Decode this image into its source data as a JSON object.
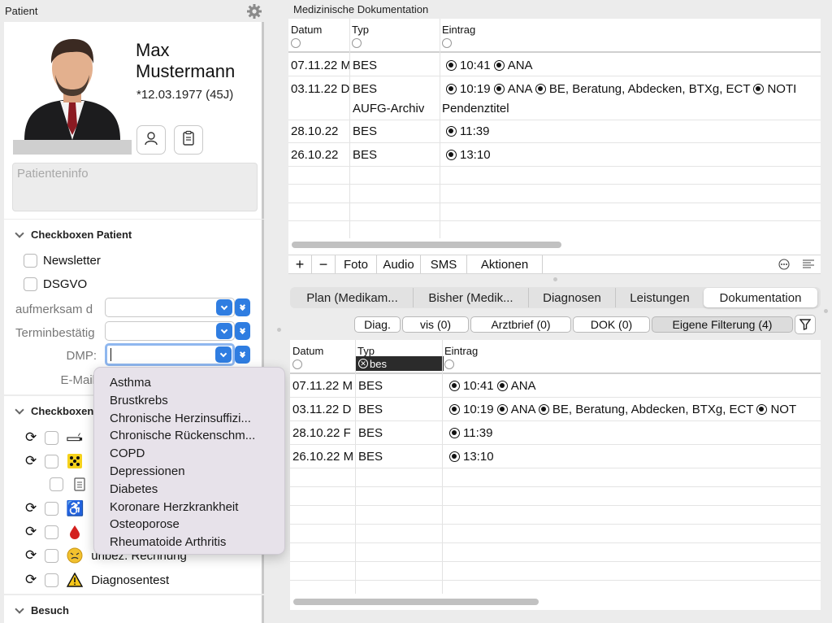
{
  "left": {
    "title": "Patient",
    "patient": {
      "first_name": "Max",
      "last_name": "Mustermann",
      "dob": "*12.03.1977 (45J)",
      "info_placeholder": "Patienteninfo"
    },
    "checkboxes_section": {
      "title": "Checkboxen Patient",
      "items": [
        {
          "label": "Newsletter",
          "checked": false
        },
        {
          "label": "DSGVO",
          "checked": false
        }
      ],
      "fields": [
        {
          "label": "aufmerksam d",
          "value": ""
        },
        {
          "label": "Terminbestätig",
          "value": ""
        },
        {
          "label": "DMP:",
          "value": ""
        },
        {
          "label": "E-Mail",
          "value": ""
        }
      ]
    },
    "checkboxes2_section": {
      "title": "Checkboxen",
      "rows": [
        {
          "icon": "cigarette-icon",
          "label": ""
        },
        {
          "icon": "yellow-dots-icon",
          "label": ""
        },
        {
          "icon": "clipboard-icon",
          "label": ""
        },
        {
          "icon": "wheelchair-icon",
          "label": ""
        },
        {
          "icon": "blood-drop-icon",
          "label": ""
        },
        {
          "icon": "dizzy-face-icon",
          "label": "unbez. Rechnung"
        },
        {
          "icon": "warning-icon",
          "label": "Diagnosentest"
        }
      ]
    },
    "besuch_section": {
      "title": "Besuch"
    },
    "dmp_dropdown": {
      "options": [
        "Asthma",
        "Brustkrebs",
        "Chronische Herzinsuffizi...",
        "Chronische Rückenschm...",
        "COPD",
        "Depressionen",
        "Diabetes",
        "Koronare Herzkrankheit",
        "Osteoporose",
        "Rheumatoide Arthritis"
      ]
    }
  },
  "right": {
    "title": "Medizinische Dokumentation",
    "top_table": {
      "columns": [
        "Datum",
        "Typ",
        "Eintrag"
      ],
      "rows": [
        {
          "datum": "07.11.22",
          "suffix": "M",
          "typ": "BES",
          "entry": [
            {
              "dot": true,
              "text": "10:41"
            },
            {
              "dot": true,
              "text": "ANA"
            }
          ]
        },
        {
          "datum": "03.11.22",
          "suffix": "D",
          "typ": "BES",
          "entry": [
            {
              "dot": true,
              "text": "10:19"
            },
            {
              "dot": true,
              "text": "ANA"
            },
            {
              "dot": true,
              "text": "BE, Beratung, Abdecken, BTXg, ECT"
            },
            {
              "dot": true,
              "text": "NOTI"
            }
          ]
        },
        {
          "datum": "",
          "suffix": "",
          "typ": "AUFG-Archiv",
          "entry": [
            {
              "dot": false,
              "text": "Pendenztitel"
            }
          ]
        },
        {
          "datum": "28.10.22",
          "suffix": "",
          "typ": "BES",
          "entry": [
            {
              "dot": true,
              "text": "11:39"
            }
          ]
        },
        {
          "datum": "26.10.22",
          "suffix": "",
          "typ": "BES",
          "entry": [
            {
              "dot": true,
              "text": "13:10"
            }
          ]
        }
      ]
    },
    "toolbar": {
      "add": "+",
      "remove": "−",
      "buttons": [
        "Foto",
        "Audio",
        "SMS",
        "Aktionen"
      ]
    },
    "tabs": [
      {
        "label": "Plan (Medikam...",
        "active": false
      },
      {
        "label": "Bisher (Medik...",
        "active": false
      },
      {
        "label": "Diagnosen",
        "active": false
      },
      {
        "label": "Leistungen",
        "active": false
      },
      {
        "label": "Dokumentation",
        "active": true
      }
    ],
    "filters": [
      {
        "label": "Diag.",
        "active": false
      },
      {
        "label": "vis (0)",
        "active": false
      },
      {
        "label": "Arztbrief (0)",
        "active": false
      },
      {
        "label": "DOK (0)",
        "active": false
      },
      {
        "label": "Eigene Filterung (4)",
        "active": true
      }
    ],
    "bottom_table": {
      "columns": [
        "Datum",
        "Typ",
        "Eintrag"
      ],
      "typ_filter_value": "bes",
      "rows": [
        {
          "datum": "07.11.22",
          "suffix": "M",
          "typ": "BES",
          "entry": [
            {
              "dot": true,
              "text": "10:41"
            },
            {
              "dot": true,
              "text": "ANA"
            }
          ]
        },
        {
          "datum": "03.11.22",
          "suffix": "D",
          "typ": "BES",
          "entry": [
            {
              "dot": true,
              "text": "10:19"
            },
            {
              "dot": true,
              "text": "ANA"
            },
            {
              "dot": true,
              "text": "BE, Beratung, Abdecken, BTXg, ECT"
            },
            {
              "dot": true,
              "text": "NOT"
            }
          ]
        },
        {
          "datum": "28.10.22",
          "suffix": "F",
          "typ": "BES",
          "entry": [
            {
              "dot": true,
              "text": "11:39"
            }
          ]
        },
        {
          "datum": "26.10.22",
          "suffix": "M",
          "typ": "BES",
          "entry": [
            {
              "dot": true,
              "text": "13:10"
            }
          ]
        }
      ]
    }
  }
}
